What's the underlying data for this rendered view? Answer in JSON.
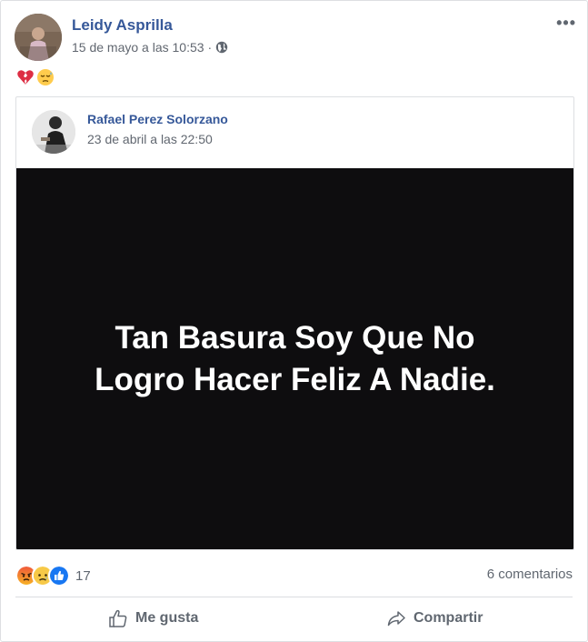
{
  "post": {
    "author": "Leidy Asprilla",
    "timestamp": "15 de mayo a las 10:53",
    "separator": "·",
    "privacy_icon": "globe-icon",
    "more_label": "•••",
    "status_emojis": [
      "broken-heart-emoji",
      "downcast-sweat-emoji"
    ]
  },
  "shared": {
    "author": "Rafael Perez Solorzano",
    "timestamp": "23 de abril a las 22:50",
    "image_text_line1": "Tan Basura Soy Que No",
    "image_text_line2": "Logro Hacer Feliz A Nadie."
  },
  "reactions": {
    "types": [
      "angry",
      "sad",
      "like"
    ],
    "count": "17",
    "comments": "6 comentarios"
  },
  "actions": {
    "like_label": "Me gusta",
    "share_label": "Compartir"
  },
  "colors": {
    "link_blue": "#365899",
    "meta_gray": "#616770",
    "image_bg": "#0e0d0f"
  }
}
